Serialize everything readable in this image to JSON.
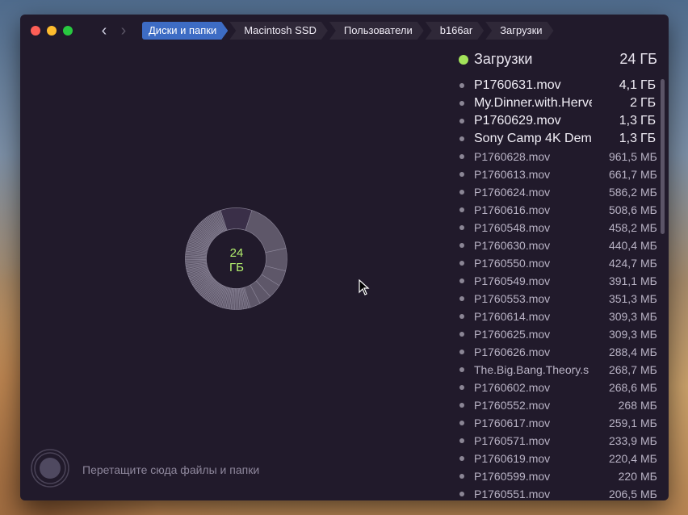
{
  "toolbar": {
    "back_label": "‹",
    "forward_label": "›",
    "breadcrumb": [
      "Диски и папки",
      "Macintosh SSD",
      "Пользователи",
      "b166ar",
      "Загрузки"
    ]
  },
  "chart": {
    "center_value": "24",
    "center_unit": "ГБ",
    "colors": {
      "ring": "#5e5769",
      "highlight": "#3a2f48",
      "divider": "#8d879a"
    }
  },
  "dropzone": {
    "label": "Перетащите сюда файлы и папки"
  },
  "panel": {
    "title": "Загрузки",
    "total": "24 ГБ",
    "dot_color": "#a3e35a",
    "items": [
      {
        "name": "P1760631.mov",
        "num": "4,1",
        "unit": "ГБ"
      },
      {
        "name": "My.Dinner.with.Herve",
        "num": "2",
        "unit": "ГБ"
      },
      {
        "name": "P1760629.mov",
        "num": "1,3",
        "unit": "ГБ"
      },
      {
        "name": "Sony Camp 4K Dem",
        "num": "1,3",
        "unit": "ГБ"
      },
      {
        "name": "P1760628.mov",
        "num": "961,5",
        "unit": "МБ"
      },
      {
        "name": "P1760613.mov",
        "num": "661,7",
        "unit": "МБ"
      },
      {
        "name": " P1760624.mov",
        "num": "586,2",
        "unit": "МБ"
      },
      {
        "name": "P1760616.mov",
        "num": "508,6",
        "unit": "МБ"
      },
      {
        "name": "P1760548.mov",
        "num": "458,2",
        "unit": "МБ"
      },
      {
        "name": "P1760630.mov",
        "num": "440,4",
        "unit": "МБ"
      },
      {
        "name": "P1760550.mov",
        "num": "424,7",
        "unit": "МБ"
      },
      {
        "name": "P1760549.mov",
        "num": "391,1",
        "unit": "МБ"
      },
      {
        "name": "P1760553.mov",
        "num": "351,3",
        "unit": "МБ"
      },
      {
        "name": "P1760614.mov",
        "num": "309,3",
        "unit": "МБ"
      },
      {
        "name": "P1760625.mov",
        "num": "309,3",
        "unit": "МБ"
      },
      {
        "name": "P1760626.mov",
        "num": "288,4",
        "unit": "МБ"
      },
      {
        "name": "The.Big.Bang.Theory.s",
        "num": "268,7",
        "unit": "МБ"
      },
      {
        "name": "P1760602.mov",
        "num": "268,6",
        "unit": "МБ"
      },
      {
        "name": "P1760552.mov",
        "num": "268",
        "unit": "МБ"
      },
      {
        "name": "P1760617.mov",
        "num": "259,1",
        "unit": "МБ"
      },
      {
        "name": "P1760571.mov",
        "num": "233,9",
        "unit": "МБ"
      },
      {
        "name": "P1760619.mov",
        "num": "220,4",
        "unit": "МБ"
      },
      {
        "name": "P1760599.mov",
        "num": "220",
        "unit": "МБ"
      },
      {
        "name": "P1760551.mov",
        "num": "206,5",
        "unit": "МБ"
      }
    ]
  }
}
